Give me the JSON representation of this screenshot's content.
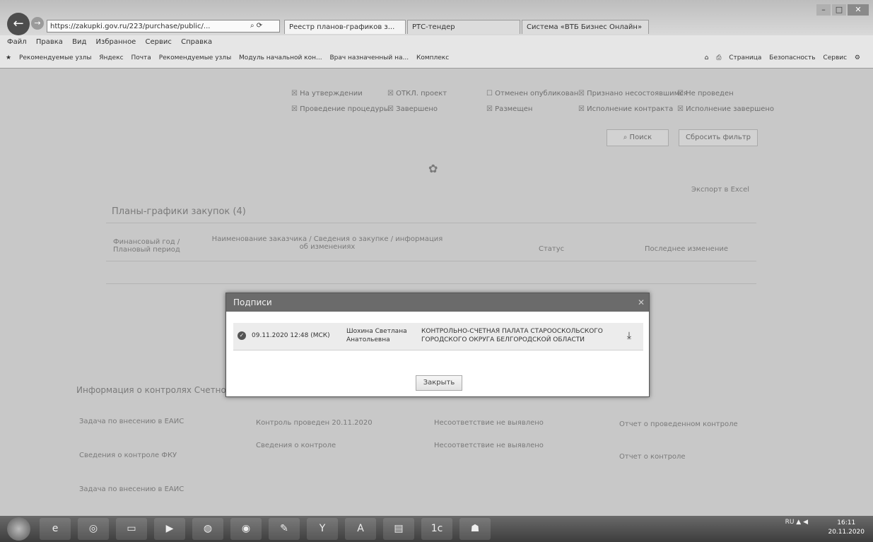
{
  "browser": {
    "address": "https://zakupki.gov.ru/223/purchase/public/...",
    "tabs": [
      "Реестр планов-графиков з...",
      "РТС-тендер",
      "Система «ВТБ Бизнес Онлайн»"
    ],
    "menu": [
      "Файл",
      "Правка",
      "Вид",
      "Избранное",
      "Сервис",
      "Справка"
    ],
    "favorites": [
      "Рекомендуемые узлы",
      "Яндекс",
      "Почта",
      "Рекомендуемые узлы",
      "Модуль начальной кон...",
      "Врач назначенный на...",
      "Комплекс"
    ],
    "command_bar": [
      "Страница",
      "Безопасность",
      "Сервис"
    ]
  },
  "page": {
    "checkbox_row1": [
      "На утверждении",
      "ОТКЛ. проект",
      "Отменен опубликован",
      "Признано несостоявшимся",
      "Не проведен"
    ],
    "checkbox_row2": [
      "Проведение процедуры",
      "Завершено",
      "Размещен",
      "Исполнение контракта",
      "Исполнение завершено"
    ],
    "search_button": "Поиск",
    "reset_button": "Сбросить фильтр",
    "section_title": "Планы-графики закупок (4)",
    "col_fin_year": "Финансовый год / Плановый период",
    "col_customer": "Наименование заказчика / Сведения о закупке / информация об изменениях",
    "col_status": "Статус",
    "col_published": "Последнее изменение",
    "faint_link": "Экспорт в Excel",
    "bottom_title": "Информация о контролях Счетной палаты",
    "rows": [
      [
        "Задача по внесению в ЕАИС",
        "Контроль проведен 20.11.2020",
        "Несоответствие не выявлено",
        "Отчет о проведенном контроле"
      ],
      [
        "Сведения о контроле ФКУ",
        "Сведения о контроле",
        "Несоответствие не выявлено",
        "Отчет о контроле"
      ],
      [
        "Задача по внесению в ЕАИС",
        "",
        "",
        ""
      ]
    ]
  },
  "modal": {
    "title": "Подписи",
    "signature": {
      "date": "09.11.2020 12:48 (МСК)",
      "signer": "Шохина Светлана Анатольевна",
      "organization": "КОНТРОЛЬНО-СЧЕТНАЯ ПАЛАТА СТАРООСКОЛЬСКОГО ГОРОДСКОГО ОКРУГА БЕЛГОРОДСКОЙ ОБЛАСТИ"
    },
    "close_button": "Закрыть"
  },
  "taskbar": {
    "time": "16:11",
    "date": "20.11.2020",
    "lang": "RU"
  }
}
